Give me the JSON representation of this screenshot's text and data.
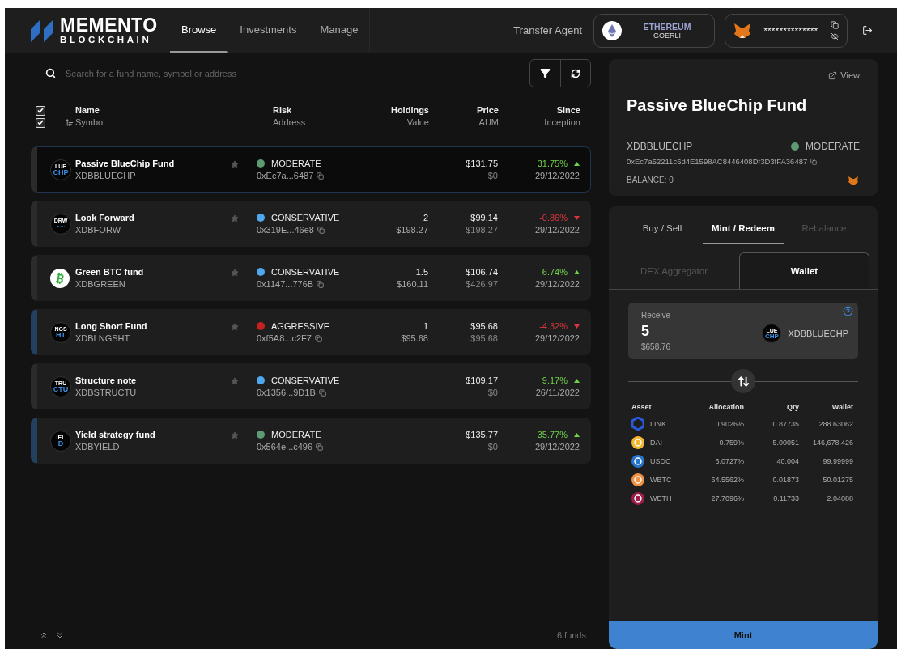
{
  "header": {
    "logo_top": "MEMENTO",
    "logo_bottom": "BLOCKCHAIN",
    "nav": [
      {
        "label": "Browse",
        "selected": true
      },
      {
        "label": "Investments",
        "selected": false
      },
      {
        "label": "Manage",
        "selected": false
      }
    ],
    "transfer_agent": "Transfer Agent",
    "network": {
      "name": "ETHEREUM",
      "sub": "GOERLI"
    },
    "wallet": {
      "address": "**************"
    }
  },
  "search": {
    "placeholder": "Search for a fund name, symbol or address"
  },
  "header_checks": [
    {
      "checked": true
    },
    {
      "checked": true
    }
  ],
  "columns": [
    {
      "top": "Name",
      "bottom": "Symbol"
    },
    {
      "top": "Risk",
      "bottom": "Address"
    },
    {
      "top": "Holdings",
      "bottom": "Value"
    },
    {
      "top": "Price",
      "bottom": "AUM"
    },
    {
      "top": "Since",
      "bottom": "Inception"
    }
  ],
  "funds": [
    {
      "name": "Passive BlueChip Fund",
      "symbol": "XDBBLUECHP",
      "logo": {
        "kind": "text",
        "top": "LUE",
        "bottom": "CHP"
      },
      "risk": "MODERATE",
      "color": "#5e9a74",
      "address": "0xEc7a...6487",
      "price": "$131.75",
      "aum": "$0",
      "change": "31.75%",
      "rising": true,
      "since": "29/12/2022",
      "selected": true,
      "accent": false
    },
    {
      "name": "Look Forward",
      "symbol": "XDBFORW",
      "logo": {
        "kind": "text",
        "top": "DRW",
        "bottom": "~~"
      },
      "risk": "CONSERVATIVE",
      "color": "#4fa8ee",
      "address": "0x319E...46e8",
      "holdings": "2",
      "value": "$198.27",
      "price": "$99.14",
      "aum": "$198.27",
      "change": "-0.86%",
      "rising": false,
      "since": "29/12/2022",
      "selected": false,
      "accent": false
    },
    {
      "name": "Green BTC fund",
      "symbol": "XDBGREEN",
      "logo": {
        "kind": "coin"
      },
      "risk": "CONSERVATIVE",
      "color": "#4fa8ee",
      "address": "0x1147...776B",
      "holdings": "1.5",
      "value": "$160.11",
      "price": "$106.74",
      "aum": "$426.97",
      "change": "6.74%",
      "rising": true,
      "since": "29/12/2022",
      "selected": false,
      "accent": false
    },
    {
      "name": "Long Short Fund",
      "symbol": "XDBLNGSHT",
      "logo": {
        "kind": "text",
        "top": "NGS",
        "bottom": "HT"
      },
      "risk": "AGGRESSIVE",
      "color": "#c62020",
      "address": "0xf5A8...c2F7",
      "holdings": "1",
      "value": "$95.68",
      "price": "$95.68",
      "aum": "$95.68",
      "change": "-4.32%",
      "rising": false,
      "since": "29/12/2022",
      "selected": false,
      "accent": true
    },
    {
      "name": "Structure note",
      "symbol": "XDBSTRUCTU",
      "logo": {
        "kind": "text",
        "top": "TRU",
        "bottom": "CTU"
      },
      "risk": "CONSERVATIVE",
      "color": "#4fa8ee",
      "address": "0x1356...9D1B",
      "price": "$109.17",
      "aum": "$0",
      "change": "9.17%",
      "rising": true,
      "since": "26/11/2022",
      "selected": false,
      "accent": false
    },
    {
      "name": "Yield strategy fund",
      "symbol": "XDBYIELD",
      "logo": {
        "kind": "text",
        "top": "IEL",
        "bottom": "D"
      },
      "risk": "MODERATE",
      "color": "#5e9a74",
      "address": "0x564e...c496",
      "price": "$135.77",
      "aum": "$0",
      "change": "35.77%",
      "rising": true,
      "since": "29/12/2022",
      "selected": false,
      "accent": true
    }
  ],
  "footer": {
    "count": "6 funds"
  },
  "detail": {
    "view": "View",
    "title": "Passive BlueChip Fund",
    "symbol": "XDBBLUECHP",
    "risk": "MODERATE",
    "color": "#5e9a74",
    "address": "0xEc7a52211c6d4E1598AC8446408Df3D3fFA36487",
    "balance": "BALANCE: 0"
  },
  "trade": {
    "tabs": [
      {
        "label": "Buy / Sell",
        "selected": false,
        "disabled": false
      },
      {
        "label": "Mint / Redeem",
        "selected": true,
        "disabled": false
      },
      {
        "label": "Rebalance",
        "selected": false,
        "disabled": true
      }
    ],
    "subtabs": [
      {
        "label": "DEX Aggregator",
        "selected": false
      },
      {
        "label": "Wallet",
        "selected": true
      }
    ],
    "receive": {
      "label": "Receive",
      "amount": "5",
      "usd": "$658.76",
      "token": "XDBBLUECHP",
      "token_logo": {
        "top": "LUE",
        "bottom": "CHP"
      }
    },
    "asset_columns": [
      "Asset",
      "Allocation",
      "Qty",
      "Wallet"
    ],
    "assets": [
      {
        "name": "LINK",
        "kind": "hexagon",
        "color": "#2a5ada",
        "allocation": "0.9026%",
        "qty": "0.87735",
        "wallet": "288.63062"
      },
      {
        "name": "DAI",
        "kind": "coin",
        "color": "#f4b731",
        "allocation": "0.759%",
        "qty": "5.00051",
        "wallet": "146,678.426"
      },
      {
        "name": "USDC",
        "kind": "coin",
        "color": "#2775ca",
        "allocation": "6.0727%",
        "qty": "40.004",
        "wallet": "99.99999"
      },
      {
        "name": "WBTC",
        "kind": "coin",
        "color": "#f09242",
        "allocation": "64.5562%",
        "qty": "0.01873",
        "wallet": "50.01275"
      },
      {
        "name": "WETH",
        "kind": "coin",
        "color": "#9c1c4a",
        "allocation": "27.7096%",
        "qty": "0.11733",
        "wallet": "2.04088"
      }
    ],
    "button": "Mint"
  }
}
